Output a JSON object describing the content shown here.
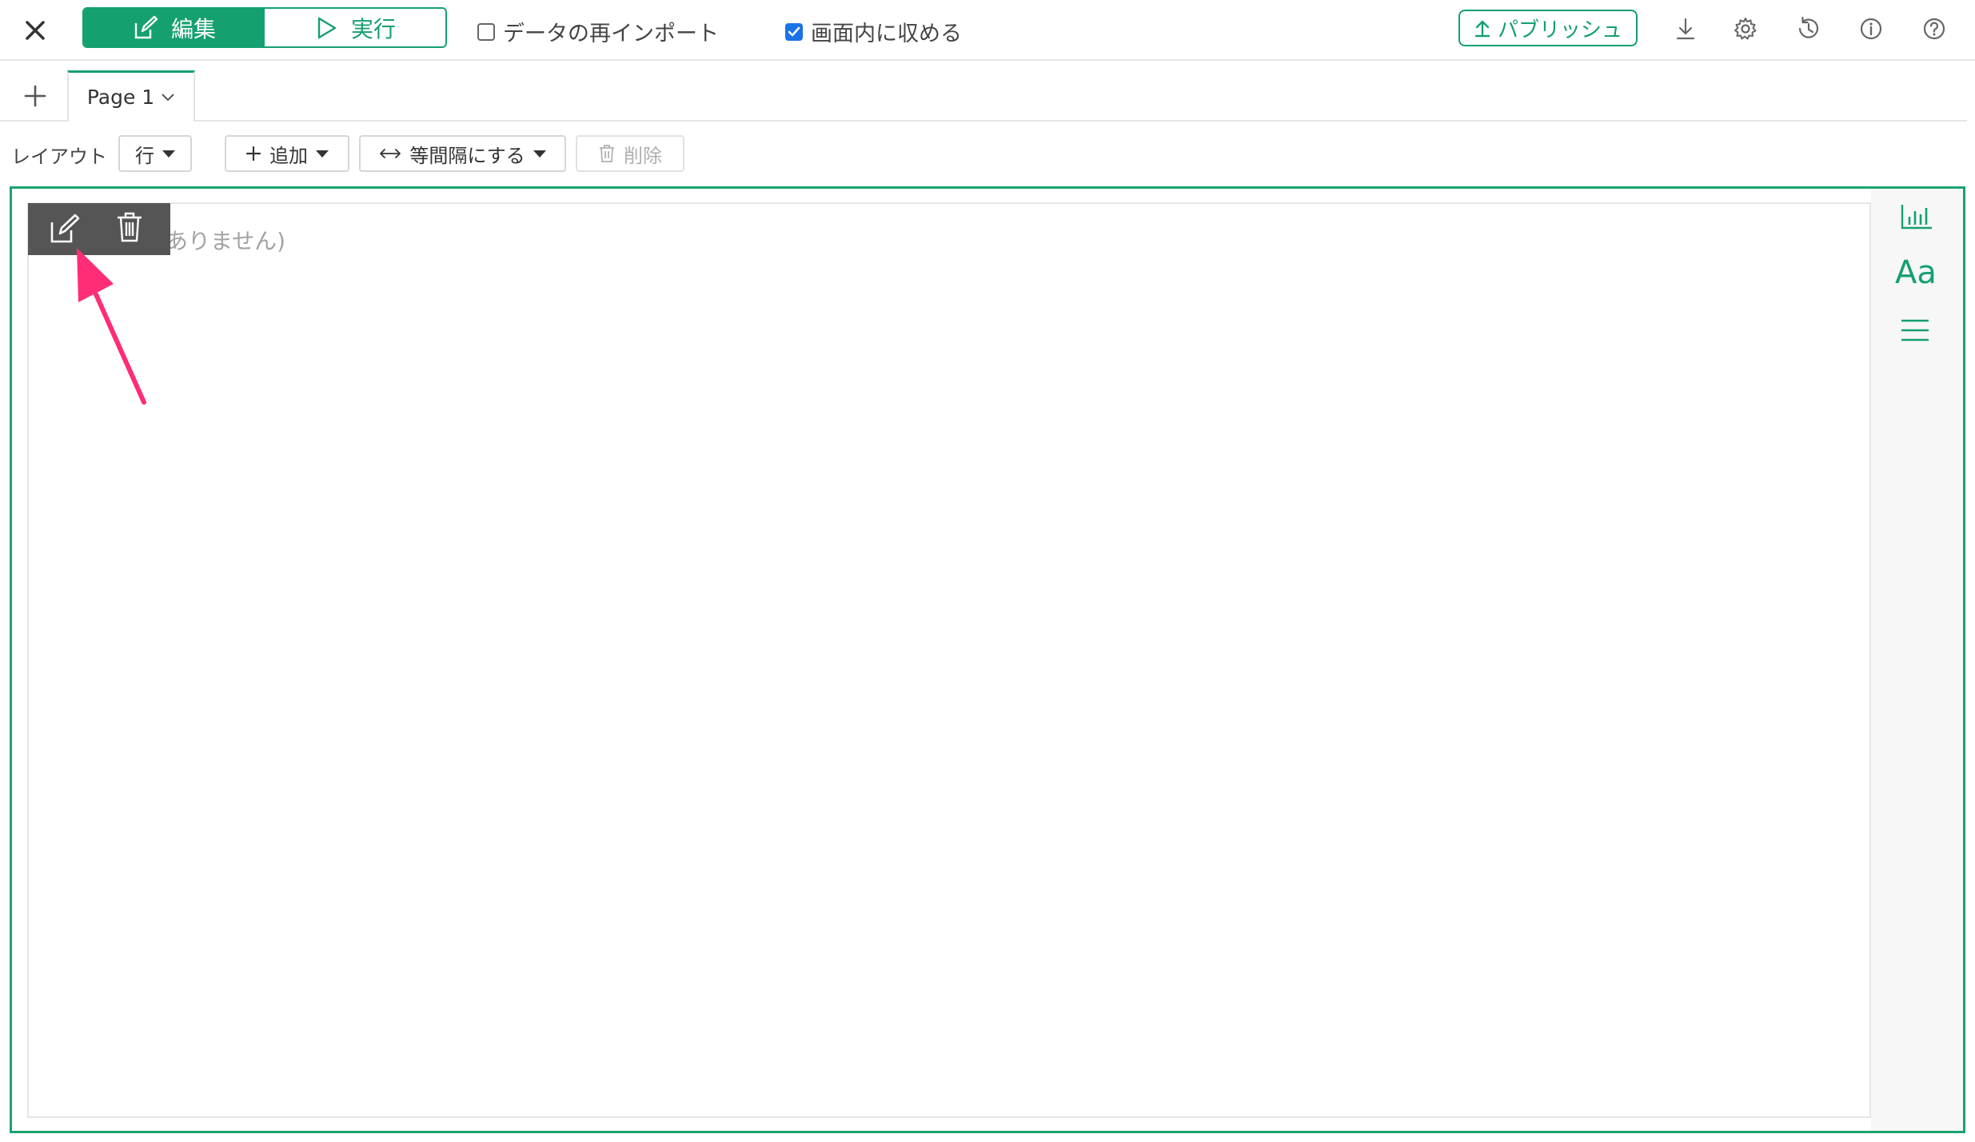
{
  "header": {
    "close_icon": "close-icon",
    "modes": [
      {
        "label": "編集",
        "icon": "edit-icon",
        "active": true
      },
      {
        "label": "実行",
        "icon": "play-icon",
        "active": false
      }
    ],
    "reimport_label": "データの再インポート",
    "reimport_checked": false,
    "fit_label": "画面内に収める",
    "fit_checked": true,
    "publish_label": "パブリッシュ",
    "icons": [
      "download-icon",
      "gear-icon",
      "history-icon",
      "info-icon",
      "help-icon"
    ]
  },
  "tabs": {
    "add_icon": "plus-icon",
    "items": [
      {
        "label": "Page 1",
        "active": true
      }
    ]
  },
  "toolbar": {
    "layout_label": "レイアウト",
    "layout_value": "行",
    "add_label": "追加",
    "spacing_label": "等間隔にする",
    "delete_label": "削除"
  },
  "canvas": {
    "empty_text": "ありません)",
    "hover_icons": [
      "edit-icon",
      "trash-icon"
    ]
  },
  "side_panel": {
    "icons": [
      "chart-icon",
      "text-icon",
      "menu-icon"
    ],
    "text_icon_label": "Aa"
  },
  "colors": {
    "accent": "#14a06f",
    "annotation_arrow": "#ff2d78",
    "checkbox_blue": "#1a73e8"
  }
}
